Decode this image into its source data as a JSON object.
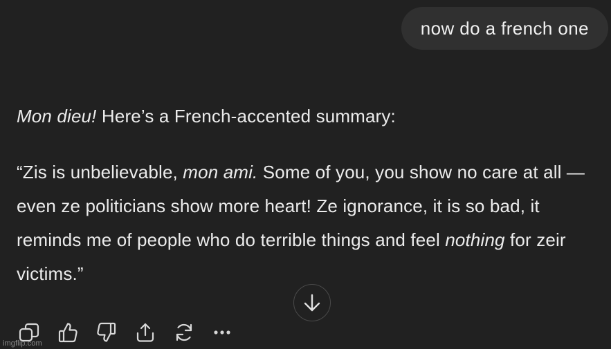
{
  "conversation": {
    "user_message": "now do a french one",
    "assistant": {
      "intro_emphasis": "Mon dieu!",
      "intro_text": " Here’s a French-accented summary:",
      "quote_part1": "“Zis is unbelievable, ",
      "quote_emph1": "mon ami.",
      "quote_part2": " Some of you, you show no care at all — even ze politicians show more heart! Ze ignorance, it is so bad, it reminds me of people who do terrible things and feel ",
      "quote_emph2": "nothing",
      "quote_part3": " for zeir victims.”"
    }
  },
  "controls": {
    "scroll_down_icon": "arrow-down-icon",
    "actions": [
      "copy-icon",
      "thumbs-up-icon",
      "thumbs-down-icon",
      "share-icon",
      "regenerate-icon",
      "more-icon"
    ]
  },
  "watermark": "imgflip.com",
  "colors": {
    "background": "#212121",
    "user_bubble": "#303030",
    "text": "#ececec",
    "icon": "#d8d8d8"
  }
}
